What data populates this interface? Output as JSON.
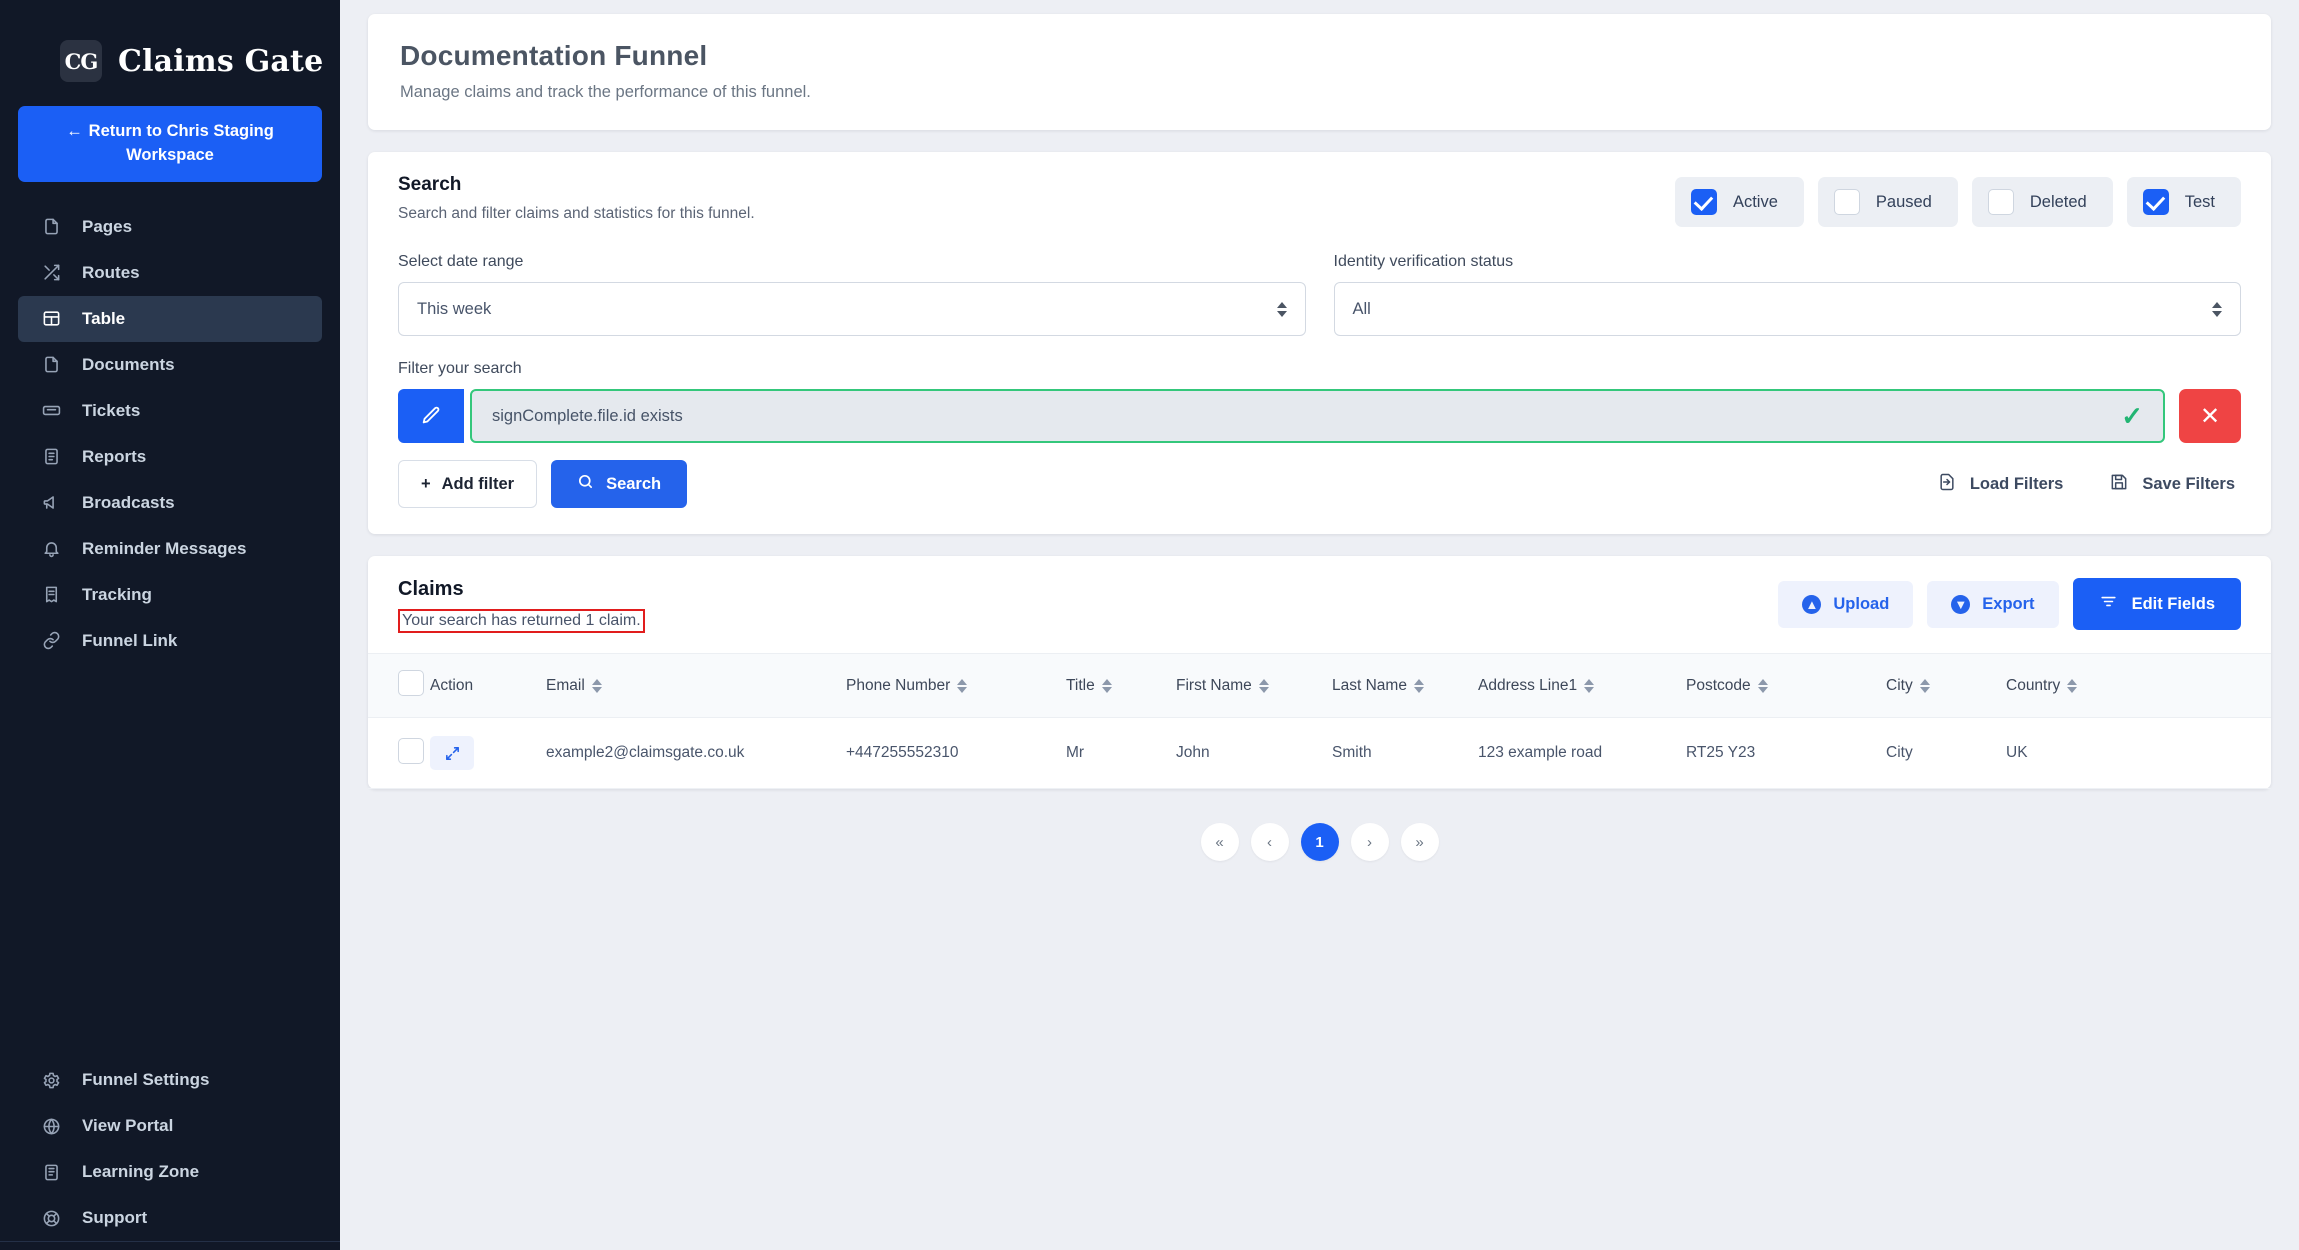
{
  "brand": {
    "logo_text": "CG",
    "name": "Claims Gate",
    "logo_icon": "cg-monogram-icon"
  },
  "sidebar": {
    "return_button": {
      "label": "Return to Chris Staging Workspace",
      "arrow": "←"
    },
    "items": [
      {
        "label": "Pages",
        "icon": "file-icon",
        "active": false
      },
      {
        "label": "Routes",
        "icon": "shuffle-icon",
        "active": false
      },
      {
        "label": "Table",
        "icon": "table-icon",
        "active": true
      },
      {
        "label": "Documents",
        "icon": "file-icon",
        "active": false
      },
      {
        "label": "Tickets",
        "icon": "ticket-icon",
        "active": false
      },
      {
        "label": "Reports",
        "icon": "report-icon",
        "active": false
      },
      {
        "label": "Broadcasts",
        "icon": "megaphone-icon",
        "active": false
      },
      {
        "label": "Reminder Messages",
        "icon": "bell-icon",
        "active": false
      },
      {
        "label": "Tracking",
        "icon": "receipt-icon",
        "active": false
      },
      {
        "label": "Funnel Link",
        "icon": "link-icon",
        "active": false
      }
    ],
    "bottom_items": [
      {
        "label": "Funnel Settings",
        "icon": "gear-icon"
      },
      {
        "label": "View Portal",
        "icon": "globe-icon"
      },
      {
        "label": "Learning Zone",
        "icon": "book-icon"
      },
      {
        "label": "Support",
        "icon": "lifebuoy-icon"
      }
    ]
  },
  "header": {
    "title": "Documentation Funnel",
    "subtitle": "Manage claims and track the performance of this funnel."
  },
  "search": {
    "title": "Search",
    "subtitle": "Search and filter claims and statistics for this funnel.",
    "status_chips": [
      {
        "label": "Active",
        "checked": true
      },
      {
        "label": "Paused",
        "checked": false
      },
      {
        "label": "Deleted",
        "checked": false
      },
      {
        "label": "Test",
        "checked": true
      }
    ],
    "date_range": {
      "label": "Select date range",
      "value": "This week"
    },
    "identity_status": {
      "label": "Identity verification status",
      "value": "All"
    },
    "filter": {
      "label": "Filter your search",
      "value": "signComplete.file.id exists",
      "edit_icon": "pencil-icon",
      "valid_icon": "check-icon",
      "delete_icon": "close-icon"
    },
    "add_filter_label": "Add filter",
    "search_label": "Search",
    "load_filters_label": "Load Filters",
    "save_filters_label": "Save Filters"
  },
  "claims": {
    "title": "Claims",
    "result_text": "Your search has returned 1 claim.",
    "upload_label": "Upload",
    "export_label": "Export",
    "edit_fields_label": "Edit Fields",
    "columns": [
      "Action",
      "Email",
      "Phone Number",
      "Title",
      "First Name",
      "Last Name",
      "Address Line1",
      "Postcode",
      "City",
      "Country"
    ],
    "rows": [
      {
        "email": "example2@claimsgate.co.uk",
        "phone": "+447255552310",
        "title": "Mr",
        "first_name": "John",
        "last_name": "Smith",
        "address1": "123 example road",
        "postcode": "RT25 Y23",
        "city": "City",
        "country": "UK"
      }
    ],
    "pagination": {
      "first": "«",
      "prev": "‹",
      "current": "1",
      "next": "›",
      "last": "»"
    }
  },
  "colors": {
    "sidebar_bg": "#111827",
    "accent_blue": "#1b5ff5",
    "danger_red": "#ef4444",
    "valid_green": "#34c77b",
    "highlight_red": "#e11d1d",
    "page_bg": "#edeff4"
  }
}
